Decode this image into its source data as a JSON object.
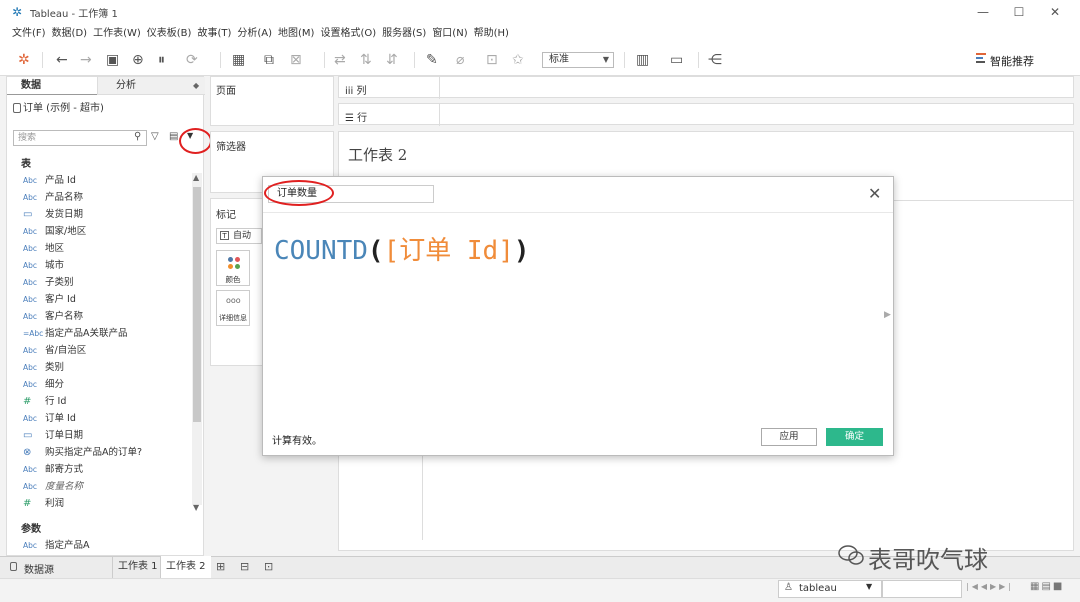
{
  "app": {
    "title": "Tableau - 工作簿 1"
  },
  "window_controls": {
    "minimize": "—",
    "maximize": "☐",
    "close": "✕"
  },
  "menu": [
    "文件(F)",
    "数据(D)",
    "工作表(W)",
    "仪表板(B)",
    "故事(T)",
    "分析(A)",
    "地图(M)",
    "设置格式(O)",
    "服务器(S)",
    "窗口(N)",
    "帮助(H)"
  ],
  "toolbar": {
    "format_select": "标准",
    "smart_recommend": "智能推荐"
  },
  "data_pane": {
    "tab_data": "数据",
    "tab_analysis": "分析",
    "datasource": "订单 (示例 - 超市)",
    "search_placeholder": "搜索",
    "table_header": "表",
    "fields": [
      {
        "type": "Abc",
        "label": "产品 Id"
      },
      {
        "type": "Abc",
        "label": "产品名称"
      },
      {
        "type": "date",
        "label": "发货日期"
      },
      {
        "type": "Abc",
        "label": "国家/地区"
      },
      {
        "type": "Abc",
        "label": "地区"
      },
      {
        "type": "Abc",
        "label": "城市"
      },
      {
        "type": "Abc",
        "label": "子类别"
      },
      {
        "type": "Abc",
        "label": "客户 Id"
      },
      {
        "type": "Abc",
        "label": "客户名称"
      },
      {
        "type": "=Abc",
        "label": "指定产品A关联产品"
      },
      {
        "type": "Abc",
        "label": "省/自治区"
      },
      {
        "type": "Abc",
        "label": "类别"
      },
      {
        "type": "Abc",
        "label": "细分"
      },
      {
        "type": "#",
        "label": "行 Id"
      },
      {
        "type": "Abc",
        "label": "订单 Id"
      },
      {
        "type": "date",
        "label": "订单日期"
      },
      {
        "type": "set",
        "label": "购买指定产品A的订单?"
      },
      {
        "type": "Abc",
        "label": "邮寄方式"
      },
      {
        "type": "Abc",
        "label": "度量名称",
        "italic": true
      },
      {
        "type": "#",
        "label": "利润"
      }
    ],
    "params_header": "参数",
    "params": [
      {
        "type": "Abc",
        "label": "指定产品A"
      }
    ]
  },
  "shelves": {
    "pages": "页面",
    "filters": "筛选器",
    "marks": "标记",
    "marks_auto": "自动",
    "marks_color": "颜色",
    "marks_detail": "详细信息",
    "columns": "列",
    "rows": "行"
  },
  "sheet": {
    "title": "工作表 2"
  },
  "calc_dialog": {
    "name": "订单数量",
    "formula_func": "COUNTD",
    "formula_open": "(",
    "formula_field": "[订单 Id]",
    "formula_close": ")",
    "status": "计算有效。",
    "apply": "应用",
    "ok": "确定",
    "close": "✕"
  },
  "bottom_tabs": {
    "datasource": "数据源",
    "sheet1": "工作表 1",
    "sheet2": "工作表 2"
  },
  "status_bar": {
    "user": "tableau"
  },
  "watermark": "表哥吹气球",
  "colors": {
    "accent_ok": "#2db88c",
    "highlight_circle": "#e02020",
    "formula_func": "#4a86b8",
    "formula_field": "#f08c3a"
  }
}
